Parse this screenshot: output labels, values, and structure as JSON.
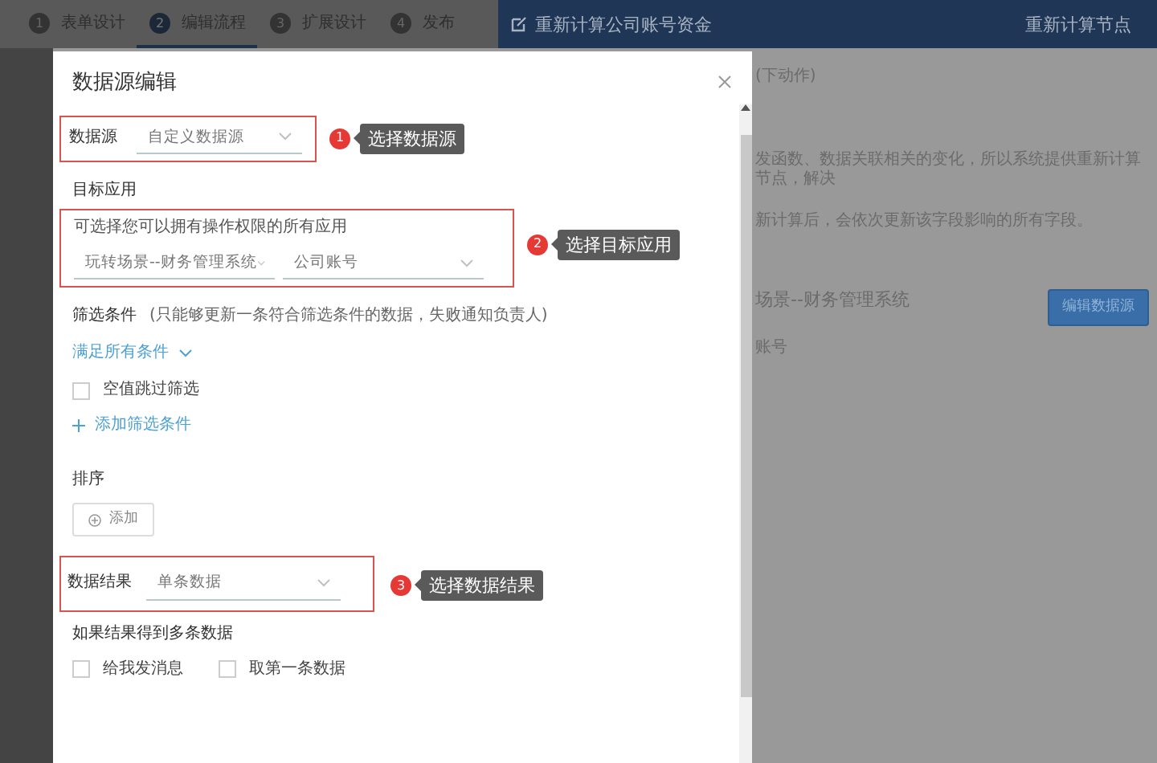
{
  "top_tabs": [
    {
      "number": "1",
      "label": "表单设计",
      "selected": false
    },
    {
      "number": "2",
      "label": "编辑流程",
      "selected": true
    },
    {
      "number": "3",
      "label": "扩展设计",
      "selected": false
    },
    {
      "number": "4",
      "label": "发布",
      "selected": false
    }
  ],
  "header": {
    "title": "重新计算公司账号资金",
    "action": "重新计算节点"
  },
  "background": {
    "lines": [
      "(下动作)",
      "发函数、数据关联相关的变化，所以系统提供重新计算节点，解决",
      "新计算后，会依次更新该字段影响的所有字段。"
    ],
    "app": "场景--财务管理系统",
    "form": "账号",
    "button": "编辑数据源"
  },
  "dialog": {
    "title": "数据源编辑",
    "data_source": {
      "label": "数据源",
      "value": "自定义数据源"
    },
    "target_app": {
      "label": "目标应用",
      "hint": "可选择您可以拥有操作权限的所有应用",
      "app_value": "玩转场景--财务管理系统",
      "form_value": "公司账号"
    },
    "filter": {
      "label": "筛选条件",
      "note": "(只能够更新一条符合筛选条件的数据，失败通知负责人)",
      "match": "满足所有条件",
      "skip_empty": {
        "label": "空值跳过筛选",
        "checked": false
      },
      "add": "添加筛选条件"
    },
    "sort": {
      "label": "排序",
      "add": "添加"
    },
    "result": {
      "label": "数据结果",
      "value": "单条数据"
    },
    "multiple": {
      "label": "如果结果得到多条数据",
      "options": [
        {
          "label": "给我发消息",
          "checked": false
        },
        {
          "label": "取第一条数据",
          "checked": false
        }
      ]
    }
  },
  "annotations": [
    {
      "number": "1",
      "label": "选择数据源"
    },
    {
      "number": "2",
      "label": "选择目标应用"
    },
    {
      "number": "3",
      "label": "选择数据结果"
    }
  ]
}
